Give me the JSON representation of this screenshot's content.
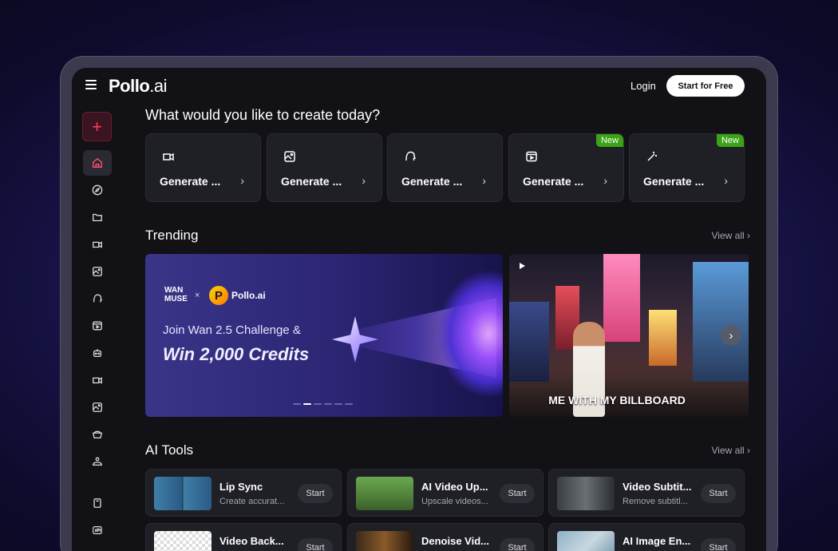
{
  "header": {
    "logo_main": "Pollo",
    "logo_suffix": ".ai",
    "login_label": "Login",
    "start_free_label": "Start for Free"
  },
  "sidebar": {
    "plus_icon": "plus-icon",
    "items": [
      {
        "icon": "home-icon",
        "active": true
      },
      {
        "icon": "compass-icon"
      },
      {
        "icon": "folder-icon"
      },
      {
        "icon": "video-icon"
      },
      {
        "icon": "image-video-icon"
      },
      {
        "icon": "ai-avatar-icon"
      },
      {
        "icon": "film-icon"
      },
      {
        "icon": "robot-icon"
      },
      {
        "icon": "video-alt-icon"
      },
      {
        "icon": "image-alt-icon"
      },
      {
        "icon": "basket-icon"
      },
      {
        "icon": "people-icon"
      },
      {
        "icon": "book-icon"
      },
      {
        "icon": "api-icon"
      }
    ]
  },
  "main": {
    "headline": "What would you like to create today?",
    "generate_cards": [
      {
        "label": "Generate ...",
        "icon": "video-generate-icon",
        "new": false
      },
      {
        "label": "Generate ...",
        "icon": "image-generate-icon",
        "new": false
      },
      {
        "label": "Generate ...",
        "icon": "ai-head-icon",
        "new": false
      },
      {
        "label": "Generate ...",
        "icon": "film-generate-icon",
        "new": true
      },
      {
        "label": "Generate ...",
        "icon": "magic-wand-icon",
        "new": true
      }
    ],
    "new_badge": "New",
    "trending": {
      "title": "Trending",
      "view_all": "View all",
      "banner": {
        "wan_logo": "WAN\nMUSE",
        "times": "×",
        "pollo_mark": "P",
        "pollo_text": "Pollo.ai",
        "line1": "Join Wan 2.5 Challenge &",
        "line2": "Win 2,000 Credits"
      },
      "video_caption": "ME WITH MY BILLBOARD"
    },
    "ai_tools": {
      "title": "AI Tools",
      "view_all": "View all",
      "start_label": "Start",
      "tools": [
        {
          "name": "Lip Sync",
          "desc": "Create accurat..."
        },
        {
          "name": "AI Video Up...",
          "desc": "Upscale videos..."
        },
        {
          "name": "Video Subtit...",
          "desc": "Remove subtitl..."
        },
        {
          "name": "Video Back...",
          "desc": ""
        },
        {
          "name": "Denoise Vid...",
          "desc": ""
        },
        {
          "name": "AI Image En...",
          "desc": ""
        }
      ]
    }
  }
}
